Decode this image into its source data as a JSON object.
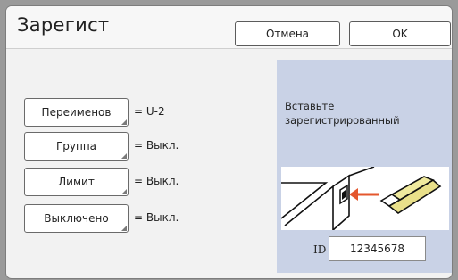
{
  "dialog": {
    "title": "Зарегист",
    "cancel_label": "Отмена",
    "ok_label": "OK"
  },
  "settings": [
    {
      "label": "Переименов",
      "value": "= U-2"
    },
    {
      "label": "Группа",
      "value": "= Выкл."
    },
    {
      "label": "Лимит",
      "value": "= Выкл."
    },
    {
      "label": "Выключено",
      "value": "= Выкл."
    }
  ],
  "panel": {
    "instruction_line1": "Вставьте",
    "instruction_line2": "зарегистрированный",
    "id_label": "ID",
    "id_value": "12345678",
    "illustration_icon": "usb-insert-icon"
  },
  "colors": {
    "panel_bg": "#c9d2e6",
    "arrow": "#e4572e",
    "usb_body": "#e9e08a"
  }
}
